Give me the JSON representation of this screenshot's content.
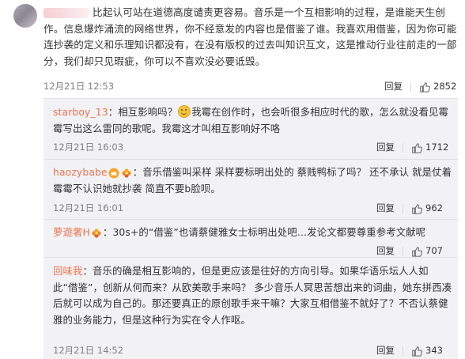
{
  "main": {
    "lead": "",
    "text": "比起认可站在道德高度谴责更容易。音乐是一个互相影响的过程，是谁能天生创作。信息爆炸涌流的网络世界，你不经意发的内容也是借鉴了谁。我喜欢用借鉴，因为你可能连抄袭的定义和乐理知识都没有，在没有版权的过去叫知识互文，这是推动行业往前走的一部分，我们却只见瑕疵，你可以不喜欢没必要诋毁。",
    "time": "12月21日 12:53",
    "reply_label": "回复",
    "likes": "2852"
  },
  "replies": [
    {
      "user": "starboy_13",
      "text_a": "：相互影响吗？",
      "text_b": "我霉在创作时，也会听很多相应时代的歌，怎么就没看见霉霉写出这么雷同的歌呢。我霉这才叫相互影响好不咯",
      "time": "12月21日 16:03",
      "reply_label": "回复",
      "likes": "1712"
    },
    {
      "user": "haozybabe",
      "text": "：音乐借鉴叫采样  采样要标明出处的  蔡贱鸭标了吗？ 还不承认  就是仗着霉霉不认识她就抄袭  简直不要b脸呗。",
      "time": "12月21日 16:01",
      "reply_label": "回复",
      "likes": "962"
    },
    {
      "user": "萝遊奢H",
      "text": "：30s+的“借鉴”也请蔡健雅女士标明出处吧…发论文都要尊重参考文献呢",
      "time": "",
      "reply_label": "回复",
      "likes": "707"
    },
    {
      "user": "回味我",
      "text": "：音乐的确是相互影响的，但是更应该是往好的方向引导。如果华语乐坛人人如此“借鉴”，创新从何而来？从欧美歌手来吗？ 多少音乐人冥思苦想出来的词曲，她东拼西凑后就可以成为自己的。那还要真正的原创歌手来干嘛？大家互相借鉴不就好了？不否认蔡健雅的业务能力，但是这种行为实在令人作呕。",
      "time": "12月21日 14:52",
      "reply_label": "回复",
      "likes": "343"
    }
  ]
}
